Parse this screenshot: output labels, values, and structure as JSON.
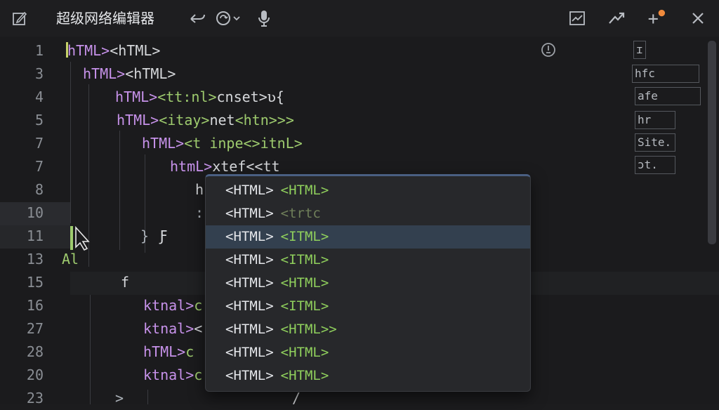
{
  "window": {
    "title": "超级网络编辑器"
  },
  "icons": {
    "edit": "edit-icon",
    "undo": "undo-icon",
    "sync": "sync-dropdown-icon",
    "mic": "microphone-icon",
    "chart": "chart-icon",
    "trend": "trend-icon",
    "add": "add-badge-icon",
    "close": "close-icon",
    "status": "status-icon"
  },
  "gutter": {
    "lines": [
      "1",
      "3",
      "4",
      "5",
      "7",
      "7",
      "8",
      "10",
      "11",
      "13",
      "15",
      "16",
      "27",
      "28",
      "20",
      "23"
    ]
  },
  "code": {
    "l1_a": "hTML>",
    "l1_b": "<hTML>",
    "l2_a": "hTML>",
    "l2_b": "<hTML>",
    "l3_a": "hTML>",
    "l3_b": "<tt:nl>",
    "l3_c": "cnset>",
    "l3_d": "ʋ{",
    "l4_a": "hTML>",
    "l4_b": "<itay>",
    "l4_c": "net",
    "l4_d": "<htn>>>",
    "l5_a": "hTML>",
    "l5_b": "<t inpe<>",
    "l5_c": "itnL>",
    "l6_a": "htmL>",
    "l6_b": "xtef<<tt",
    "l7_a": "h",
    "l8_a": ":",
    "l9_a": "}",
    "l9_b": "Ƒ",
    "l10_a": "Al",
    "l11_a": "f",
    "l12_a": "ktnal>",
    "l12_b": "c",
    "l13_a": "ktnal>",
    "l13_b": "<",
    "l14_a": "hTML>",
    "l14_b": "c",
    "l15_a": "ktnal>",
    "l15_b": "c",
    "l16_a": ">",
    "l16_b": "/"
  },
  "minimap": {
    "items": [
      "ɪ",
      "hfc",
      "afe",
      "hr",
      "Site.",
      "ɔt."
    ]
  },
  "suggestions": [
    {
      "label": "<HTML>",
      "detail": "<HTML>"
    },
    {
      "label": "<HTML>",
      "detail": "<trtc"
    },
    {
      "label": "<HTML>",
      "detail": "<ITML>"
    },
    {
      "label": "<HTML>",
      "detail": "<ITML>"
    },
    {
      "label": "<HTML>",
      "detail": "<HTML>"
    },
    {
      "label": "<HTML>",
      "detail": "<ITML>"
    },
    {
      "label": "<HTML>",
      "detail": "<HTML>>"
    },
    {
      "label": "<HTML>",
      "detail": "<HTML>"
    },
    {
      "label": "<HTML>",
      "detail": "<HTML>"
    }
  ],
  "colors": {
    "keyword": "#c792ea",
    "tag": "#9ecb6e",
    "selection": "#33404f",
    "badge": "#f08a3c",
    "cursor": "#c7d36a"
  }
}
